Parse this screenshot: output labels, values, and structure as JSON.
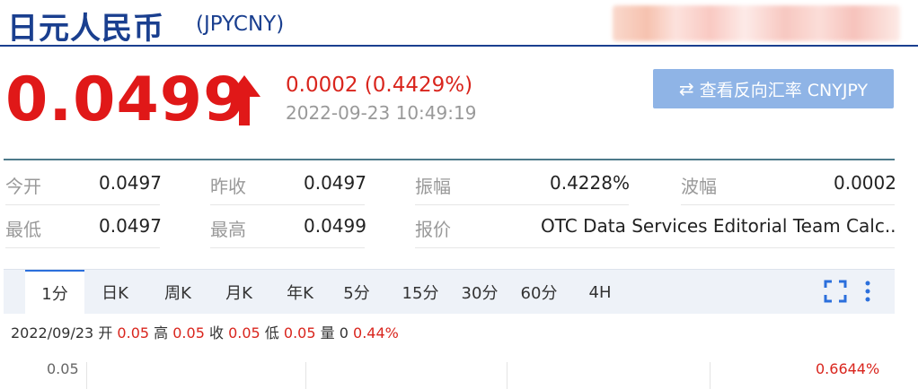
{
  "header": {
    "title": "日元人民币",
    "code": "(JPYCNY)"
  },
  "quote": {
    "price": "0.0499",
    "change": "0.0002 (0.4429%)",
    "timestamp": "2022-09-23 10:49:19",
    "reverse_button": "查看反向汇率 CNYJPY",
    "colors": {
      "up": "#e01818",
      "brand": "#1a3f8f",
      "button": "#8fb4e6"
    }
  },
  "stats": [
    {
      "label": "今开",
      "value": "0.0497"
    },
    {
      "label": "昨收",
      "value": "0.0497"
    },
    {
      "label": "振幅",
      "value": "0.4228%"
    },
    {
      "label": "波幅",
      "value": "0.0002"
    },
    {
      "label": "最低",
      "value": "0.0497"
    },
    {
      "label": "最高",
      "value": "0.0499"
    },
    {
      "label": "报价",
      "value": "OTC Data Services Editorial Team Calc..."
    }
  ],
  "chart_tabs": [
    "1分",
    "日K",
    "周K",
    "月K",
    "年K",
    "5分",
    "15分",
    "30分",
    "60分",
    "4H"
  ],
  "active_tab": "1分",
  "toolbar_icons": [
    "fullscreen-icon",
    "more-vertical-icon"
  ],
  "ohlc": {
    "date": "2022/09/23",
    "open_label": "开",
    "open": "0.05",
    "high_label": "高",
    "high": "0.05",
    "close_label": "收",
    "close": "0.05",
    "low_label": "低",
    "low": "0.05",
    "volume_label": "量",
    "volume": "0",
    "change_pct": "0.44%"
  },
  "chart": {
    "y_top_label": "0.05",
    "pct_top_label": "0.6644%"
  }
}
